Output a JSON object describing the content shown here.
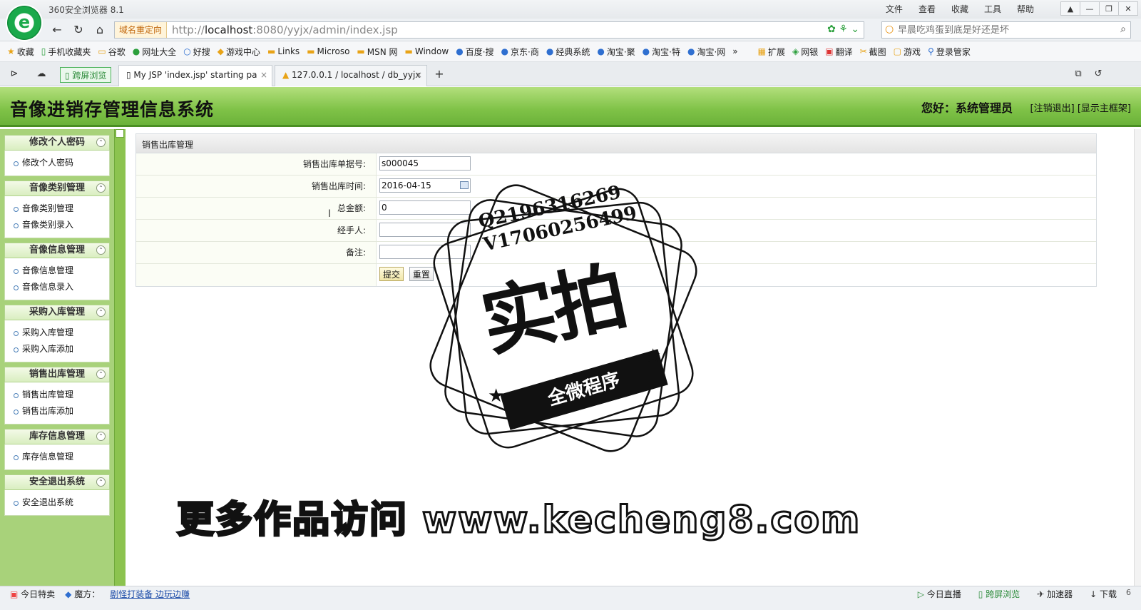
{
  "browser": {
    "title": "360安全浏览器 8.1",
    "menu": [
      "文件",
      "查看",
      "收藏",
      "工具",
      "帮助"
    ],
    "redirect_label": "域名重定向",
    "url_prefix": "http://",
    "url_host": "localhost",
    "url_rest": ":8080/yyjx/admin/index.jsp",
    "search_placeholder": "早晨吃鸡蛋到底是好还是坏",
    "favorites": [
      "收藏",
      "手机收藏夹",
      "谷歌",
      "网址大全",
      "好搜",
      "游戏中心",
      "Links",
      "Microso",
      "MSN 网",
      "Window",
      "百度·搜",
      "京东·商",
      "经典系统",
      "淘宝·聚",
      "淘宝·特",
      "淘宝·网"
    ],
    "tools": [
      "扩展",
      "网银",
      "翻译",
      "截图",
      "游戏",
      "登录管家"
    ],
    "kp_label": "跨屏浏览",
    "tabs": [
      {
        "label": "My JSP 'index.jsp' starting pa"
      },
      {
        "label": "127.0.0.1 / localhost / db_yyjx"
      }
    ]
  },
  "app": {
    "title": "音像进销存管理信息系统",
    "greeting": "您好：系统管理员",
    "logout": "[注销退出]",
    "show_frame": "[显示主框架]"
  },
  "sidebar": {
    "sections": [
      {
        "header": "修改个人密码",
        "items": [
          "修改个人密码"
        ]
      },
      {
        "header": "音像类别管理",
        "items": [
          "音像类别管理",
          "音像类别录入"
        ]
      },
      {
        "header": "音像信息管理",
        "items": [
          "音像信息管理",
          "音像信息录入"
        ]
      },
      {
        "header": "采购入库管理",
        "items": [
          "采购入库管理",
          "采购入库添加"
        ]
      },
      {
        "header": "销售出库管理",
        "items": [
          "销售出库管理",
          "销售出库添加"
        ]
      },
      {
        "header": "库存信息管理",
        "items": [
          "库存信息管理"
        ]
      },
      {
        "header": "安全退出系统",
        "items": [
          "安全退出系统"
        ]
      }
    ]
  },
  "form": {
    "title": "销售出库管理",
    "fields": [
      {
        "label": "销售出库单据号:",
        "value": "s000045"
      },
      {
        "label": "销售出库时间:",
        "value": "2016-04-15"
      },
      {
        "label": "总金额:",
        "value": "0"
      },
      {
        "label": "经手人:",
        "value": ""
      },
      {
        "label": "备注:",
        "value": ""
      }
    ],
    "submit": "提交",
    "reset": "重置"
  },
  "watermark": {
    "contact_q": "Q2196316269",
    "contact_v": "V17060256499",
    "big": "实拍",
    "banner": "全微程序",
    "footer": "更多作品访问 www.kecheng8.com"
  },
  "statusbar": {
    "left": [
      "今日特卖",
      "魔方：",
      "剧怪打装备 边玩边赚"
    ],
    "right": [
      "今日直播",
      "跨屏浏览",
      "加速器",
      "下载"
    ],
    "zoom": "6"
  }
}
